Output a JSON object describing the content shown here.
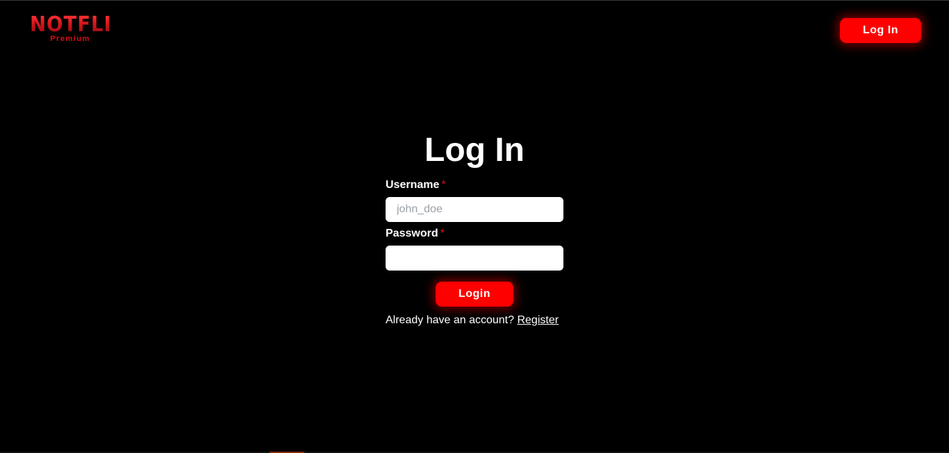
{
  "header": {
    "logo_text": "NOTFLIX",
    "logo_subtext": "Premium",
    "login_button_label": "Log In"
  },
  "form": {
    "title": "Log In",
    "username_label": "Username",
    "username_placeholder": "john_doe",
    "username_value": "",
    "password_label": "Password",
    "password_value": "",
    "required_marker": "*",
    "submit_label": "Login",
    "register_prompt": "Already have an account?",
    "register_link": "Register"
  },
  "colors": {
    "background": "#000000",
    "accent": "#ff0000",
    "text": "#ffffff",
    "placeholder": "#9aa0a8"
  }
}
